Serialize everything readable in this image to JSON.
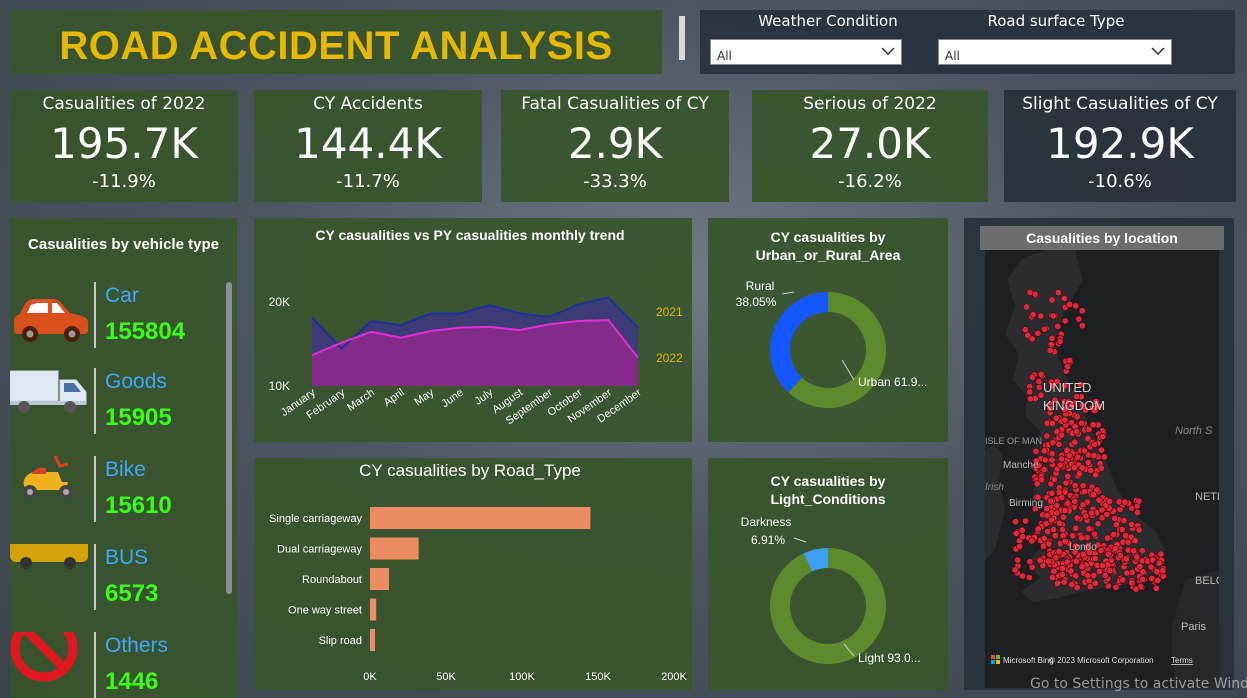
{
  "header": {
    "title": "ROAD ACCIDENT ANALYSIS"
  },
  "filters": [
    {
      "label": "Weather Condition",
      "value": "All"
    },
    {
      "label": "Road surface Type",
      "value": "All"
    }
  ],
  "kpis": [
    {
      "title": "Casualities of 2022",
      "value": "195.7K",
      "change": "-11.9%"
    },
    {
      "title": "CY Accidents",
      "value": "144.4K",
      "change": "-11.7%"
    },
    {
      "title": "Fatal Casualities of CY",
      "value": "2.9K",
      "change": "-33.3%"
    },
    {
      "title": "Serious of 2022",
      "value": "27.0K",
      "change": "-16.2%"
    },
    {
      "title": "Slight Casualities of CY",
      "value": "192.9K",
      "change": "-10.6%"
    }
  ],
  "vehicles": {
    "title": "Casualities by vehicle type",
    "items": [
      {
        "name": "Car",
        "value": "155804",
        "icon": "car-icon"
      },
      {
        "name": "Goods",
        "value": "15905",
        "icon": "truck-icon"
      },
      {
        "name": "Bike",
        "value": "15610",
        "icon": "scooter-icon"
      },
      {
        "name": "BUS",
        "value": "6573",
        "icon": "bus-icon"
      },
      {
        "name": "Others",
        "value": "1446",
        "icon": "prohibited-icon"
      }
    ]
  },
  "chart_data": [
    {
      "type": "area",
      "title": "CY casualities vs PY casualities monthly trend",
      "categories": [
        "January",
        "February",
        "March",
        "April",
        "May",
        "June",
        "July",
        "August",
        "September",
        "October",
        "November",
        "December"
      ],
      "series": [
        {
          "name": "2021",
          "values": [
            18200,
            14500,
            17800,
            17300,
            18700,
            18700,
            19700,
            18700,
            18300,
            19800,
            20600,
            17000
          ],
          "color": "#1f2f9e"
        },
        {
          "name": "2022",
          "values": [
            13700,
            15200,
            16500,
            15800,
            16600,
            17000,
            17100,
            16700,
            17400,
            17800,
            17900,
            13400
          ],
          "color": "#e22fd1"
        }
      ],
      "yticks": [
        "10K",
        "20K"
      ],
      "ylim": [
        10000,
        22000
      ]
    },
    {
      "type": "bar",
      "title": "CY casualities by Road_Type",
      "categories": [
        "Single carriageway",
        "Dual carriageway",
        "Roundabout",
        "One way street",
        "Slip road"
      ],
      "values": [
        145000,
        32000,
        12500,
        4100,
        3300
      ],
      "xticks": [
        "0K",
        "50K",
        "100K",
        "150K",
        "200K"
      ],
      "xlim": [
        0,
        200000
      ],
      "color": "#eb8c62"
    },
    {
      "type": "pie",
      "title": "CY casualities by Urban_or_Rural_Area",
      "slices": [
        {
          "label": "Rural",
          "value": 38.05,
          "display": "38.05%",
          "color": "#1457ff"
        },
        {
          "label": "Urban",
          "value": 61.95,
          "display": "Urban 61.9...",
          "color": "#5e8a2d"
        }
      ]
    },
    {
      "type": "pie",
      "title": "CY casualities by Light_Conditions",
      "slices": [
        {
          "label": "Darkness",
          "value": 6.91,
          "display": "6.91%",
          "color": "#3fa0f0"
        },
        {
          "label": "Light",
          "value": 93.09,
          "display": "Light 93.0...",
          "color": "#5e8a2d"
        }
      ]
    }
  ],
  "map": {
    "title": "Casualities by location",
    "labels": [
      "UNITED",
      "KINGDOM",
      "North S",
      "NETHE",
      "BELG",
      "Paris",
      "Manche",
      "Birming",
      "Londo",
      "ISLE OF MAN",
      "Irish"
    ],
    "attribution": "© 2023 Microsoft Corporation",
    "terms": "Terms",
    "brand": "Microsoft Bing"
  },
  "watermark": "Go to Settings to activate Windows."
}
